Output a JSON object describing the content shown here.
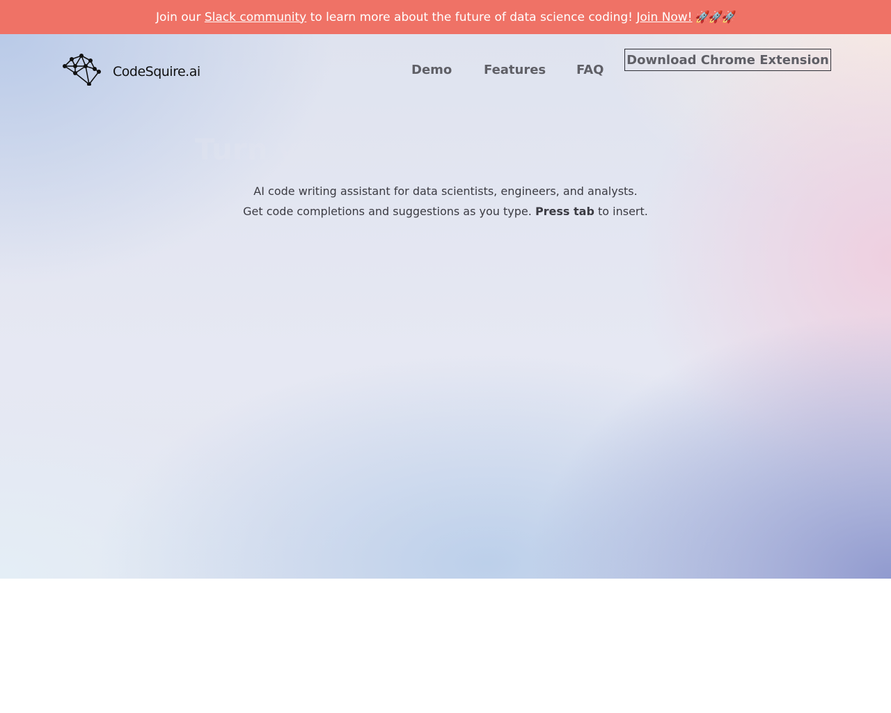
{
  "banner": {
    "prefix": "Join our",
    "slack_link": "Slack community",
    "middle": "to learn more about the future of data science coding!",
    "join_link": "Join Now!",
    "rockets": "🚀🚀🚀"
  },
  "brand": {
    "name": "CodeSquire.ai",
    "logo_icon": "network-brain-icon"
  },
  "nav": {
    "demo": "Demo",
    "features": "Features",
    "faq": "FAQ",
    "cta": "Download Chrome Extension"
  },
  "hero": {
    "headline": "Turn your comments into code",
    "line1": "AI code writing assistant for data scientists, engineers, and analysts.",
    "line2_prefix": "Get code completions and suggestions as you type.",
    "line2_bold": "Press tab",
    "line2_suffix": "to insert."
  },
  "colors": {
    "banner_bg": "#ef7266",
    "nav_text": "#5f5f66",
    "body_text": "#3b3b42"
  }
}
